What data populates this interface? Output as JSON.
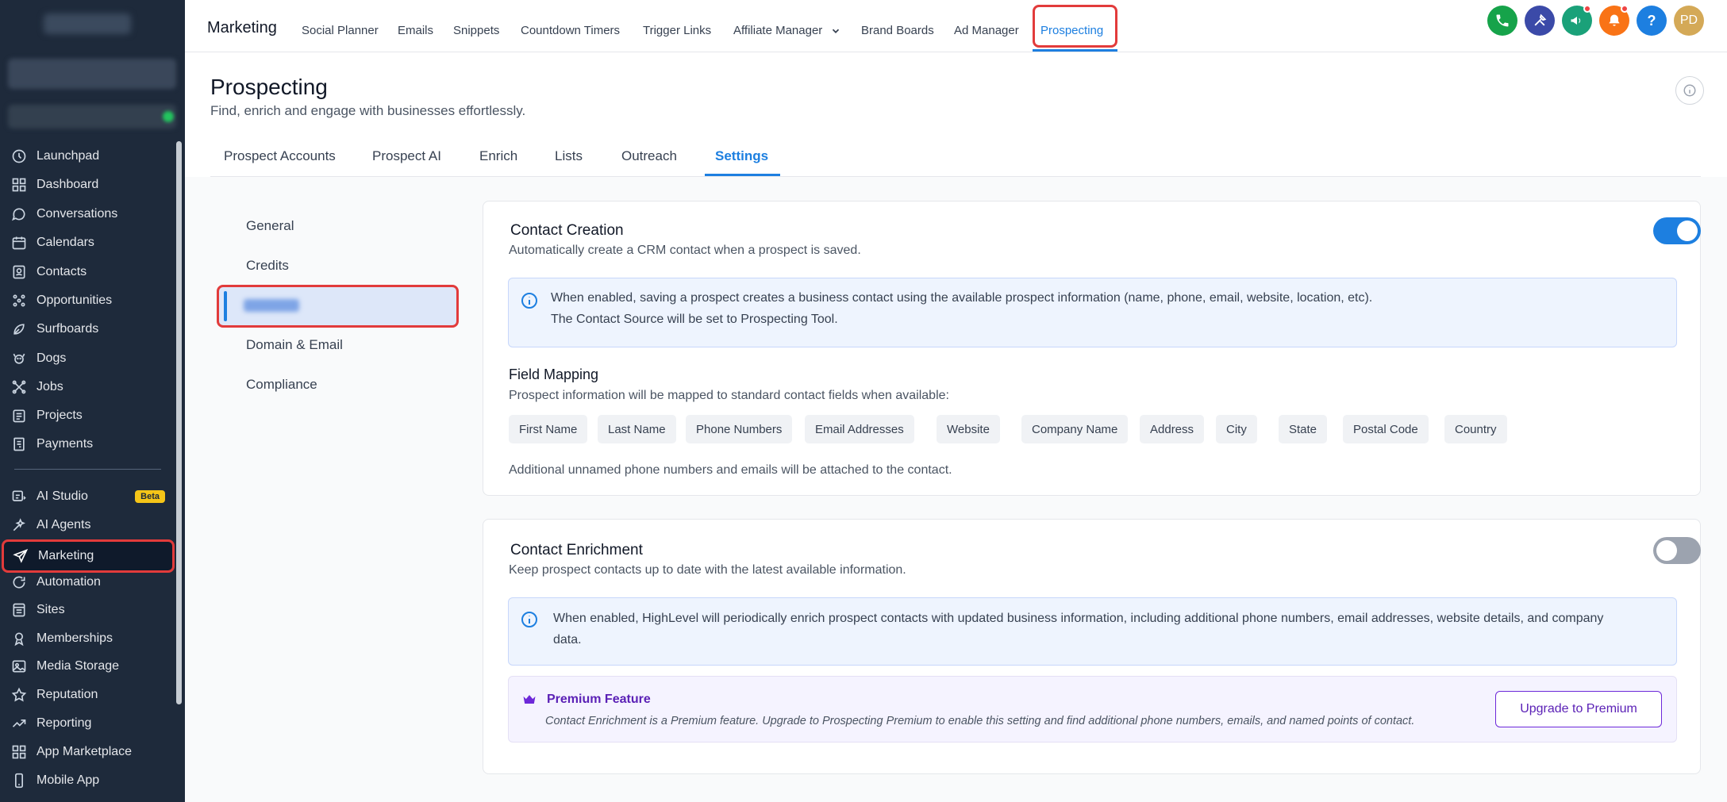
{
  "sidebar": {
    "items": [
      {
        "label": "Launchpad",
        "icon": "launchpad-icon"
      },
      {
        "label": "Dashboard",
        "icon": "dashboard-icon"
      },
      {
        "label": "Conversations",
        "icon": "chat-icon"
      },
      {
        "label": "Calendars",
        "icon": "calendar-icon"
      },
      {
        "label": "Contacts",
        "icon": "contacts-icon"
      },
      {
        "label": "Opportunities",
        "icon": "opportunities-icon"
      },
      {
        "label": "Surfboards",
        "icon": "surfboard-icon"
      },
      {
        "label": "Dogs",
        "icon": "dog-icon"
      },
      {
        "label": "Jobs",
        "icon": "jobs-icon"
      },
      {
        "label": "Projects",
        "icon": "projects-icon"
      },
      {
        "label": "Payments",
        "icon": "payments-icon"
      }
    ],
    "items2": [
      {
        "label": "AI Studio",
        "icon": "ai-studio-icon",
        "badge": "Beta"
      },
      {
        "label": "AI Agents",
        "icon": "ai-agents-icon"
      },
      {
        "label": "Marketing",
        "icon": "send-icon",
        "active": true
      },
      {
        "label": "Automation",
        "icon": "automation-icon"
      },
      {
        "label": "Sites",
        "icon": "sites-icon"
      },
      {
        "label": "Memberships",
        "icon": "memberships-icon"
      },
      {
        "label": "Media Storage",
        "icon": "media-icon"
      },
      {
        "label": "Reputation",
        "icon": "star-icon"
      },
      {
        "label": "Reporting",
        "icon": "reporting-icon"
      },
      {
        "label": "App Marketplace",
        "icon": "marketplace-icon"
      },
      {
        "label": "Mobile App",
        "icon": "mobile-icon"
      }
    ]
  },
  "topbar": {
    "title": "Marketing",
    "links": [
      "Social Planner",
      "Emails",
      "Snippets",
      "Countdown Timers",
      "Trigger Links",
      "Affiliate Manager",
      "Brand Boards",
      "Ad Manager",
      "Prospecting"
    ],
    "active": "Prospecting",
    "avatar": "PD",
    "help": "?",
    "colors": {
      "phone": "#16a34a",
      "tools": "#3b4aa8",
      "megaphone": "#1aa179",
      "bell": "#f97316",
      "help": "#1d7fe0",
      "avatar": "#d4a957"
    }
  },
  "page": {
    "title": "Prospecting",
    "subtitle": "Find, enrich and engage with businesses effortlessly."
  },
  "tabs": [
    "Prospect Accounts",
    "Prospect AI",
    "Enrich",
    "Lists",
    "Outreach",
    "Settings"
  ],
  "settings_nav": {
    "general": "General",
    "credits": "Credits",
    "domain": "Domain & Email",
    "compliance": "Compliance"
  },
  "contact_creation": {
    "title": "Contact Creation",
    "description": "Automatically create a CRM contact when a prospect is saved.",
    "enabled": true,
    "note_line1": "When enabled, saving a prospect creates a business contact using the available prospect information (name, phone, email, website, location, etc).",
    "note_line2": "The Contact Source will be set to Prospecting Tool.",
    "field_mapping_title": "Field Mapping",
    "field_mapping_desc": "Prospect information will be mapped to standard contact fields when available:",
    "fields": [
      "First Name",
      "Last Name",
      "Phone Numbers",
      "Email Addresses",
      "Website",
      "Company Name",
      "Address",
      "City",
      "State",
      "Postal Code",
      "Country"
    ],
    "footer": "Additional unnamed phone numbers and emails will be attached to the contact."
  },
  "contact_enrichment": {
    "title": "Contact Enrichment",
    "description": "Keep prospect contacts up to date with the latest available information.",
    "enabled": false,
    "note_line1": "When enabled, HighLevel will periodically enrich prospect contacts with updated business information, including additional phone numbers, email addresses, website details, and company",
    "note_line2": "data.",
    "premium_title": "Premium Feature",
    "premium_desc": "Contact Enrichment is a Premium feature. Upgrade to Prospecting Premium to enable this setting and find additional phone numbers, emails, and named points of contact.",
    "upgrade_label": "Upgrade to Premium"
  },
  "accent": "#1d7fe0",
  "highlight": "#e23b3b"
}
